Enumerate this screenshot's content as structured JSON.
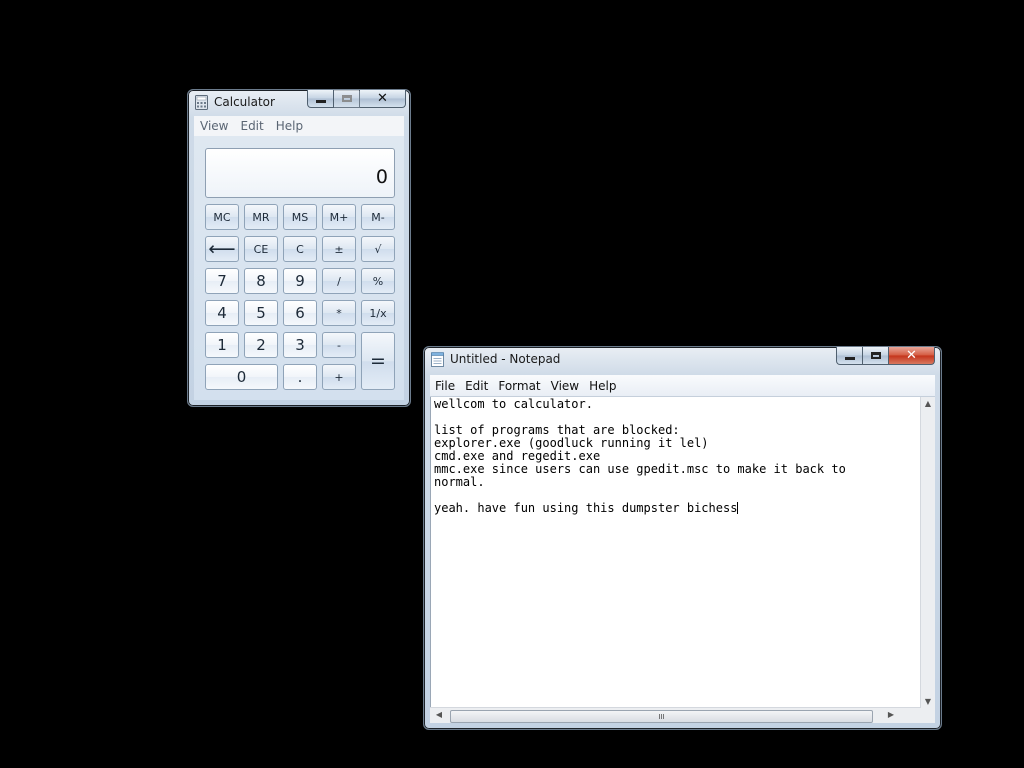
{
  "calculator": {
    "title": "Calculator",
    "menu": [
      "View",
      "Edit",
      "Help"
    ],
    "display": "0",
    "memory_row": [
      "MC",
      "MR",
      "MS",
      "M+",
      "M-"
    ],
    "row2": [
      "⟵",
      "CE",
      "C",
      "±",
      "√"
    ],
    "row3": [
      "7",
      "8",
      "9",
      "/",
      "%"
    ],
    "row4": [
      "4",
      "5",
      "6",
      "*",
      "1/x"
    ],
    "row5": [
      "1",
      "2",
      "3",
      "-"
    ],
    "row6": [
      "0",
      ".",
      "+"
    ],
    "equals": "="
  },
  "notepad": {
    "title": "Untitled - Notepad",
    "menu": [
      "File",
      "Edit",
      "Format",
      "View",
      "Help"
    ],
    "text": "wellcom to calculator.\n\nlist of programs that are blocked:\nexplorer.exe (goodluck running it lel)\ncmd.exe and regedit.exe\nmmc.exe since users can use gpedit.msc to make it back to\nnormal.\n\nyeah. have fun using this dumpster bichess",
    "scroll_thumb_grip": "III"
  },
  "icons": {
    "calculator_app": "calculator-icon",
    "notepad_app": "notepad-icon",
    "minimize": "minimize-icon",
    "maximize": "maximize-icon",
    "close": "close-icon"
  }
}
